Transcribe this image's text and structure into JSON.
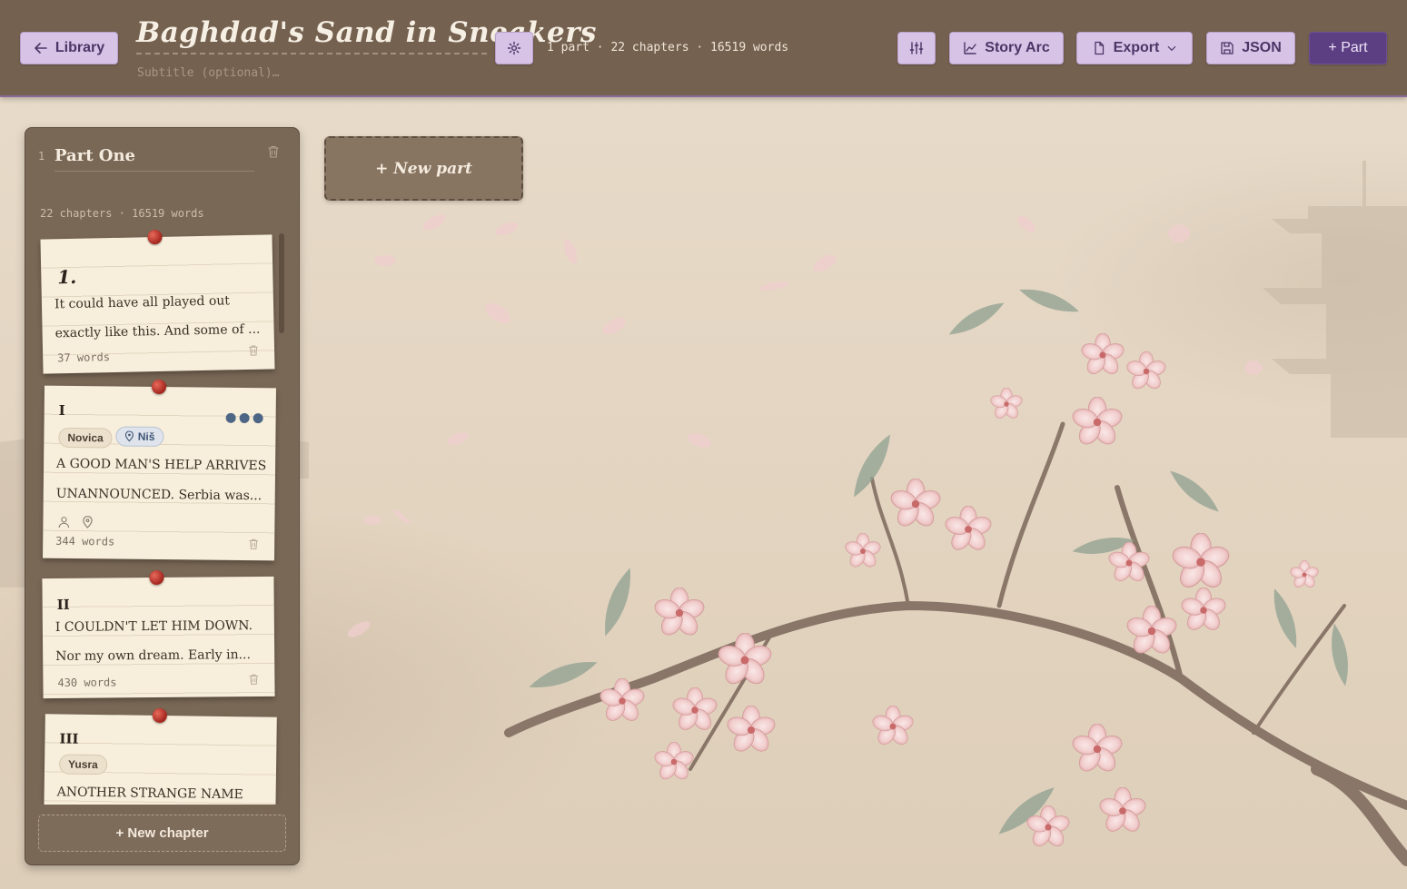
{
  "header": {
    "library_label": "Library",
    "title": "Baghdad's Sand in Sneakers",
    "subtitle_placeholder": "Subtitle (optional)…",
    "stats": "1 part · 22 chapters · 16519 words",
    "story_arc_label": "Story Arc",
    "export_label": "Export",
    "json_label": "JSON",
    "add_part_label": "+ Part"
  },
  "part": {
    "number": "1",
    "name": "Part One",
    "stats": "22 chapters · 16519 words",
    "new_chapter_label": "+ New chapter"
  },
  "chapters": [
    {
      "numeral": "1.",
      "excerpt_1": "It could have all played out",
      "excerpt_2": "exactly like this. And some of ...",
      "words": "37 words"
    },
    {
      "numeral": "I",
      "tag_character": "Novica",
      "tag_location": "Niš",
      "excerpt_1": "A GOOD MAN'S HELP ARRIVES",
      "excerpt_2": "UNANNOUNCED. Serbia was...",
      "words": "344 words"
    },
    {
      "numeral": "II",
      "excerpt_1": "I COULDN'T LET HIM DOWN.",
      "excerpt_2": "Nor my own dream. Early in...",
      "words": "430 words"
    },
    {
      "numeral": "III",
      "tag_character": "Yusra",
      "excerpt_1": "ANOTHER STRANGE NAME"
    }
  ],
  "new_part_label": "+ New part",
  "colors": {
    "header_bg": "#75614f",
    "button_bg": "#d7c3e6",
    "button_text": "#4b3566",
    "primary_button": "#5b3f82",
    "panel_bg": "#7a6856",
    "card_bg": "#f7eedb",
    "pin": "#c9382b"
  },
  "icons": [
    "arrow-left-icon",
    "gear-icon",
    "sliders-icon",
    "chart-line-icon",
    "file-icon",
    "chevron-down-icon",
    "save-icon",
    "plus-icon",
    "trash-icon",
    "person-icon",
    "map-pin-icon"
  ]
}
